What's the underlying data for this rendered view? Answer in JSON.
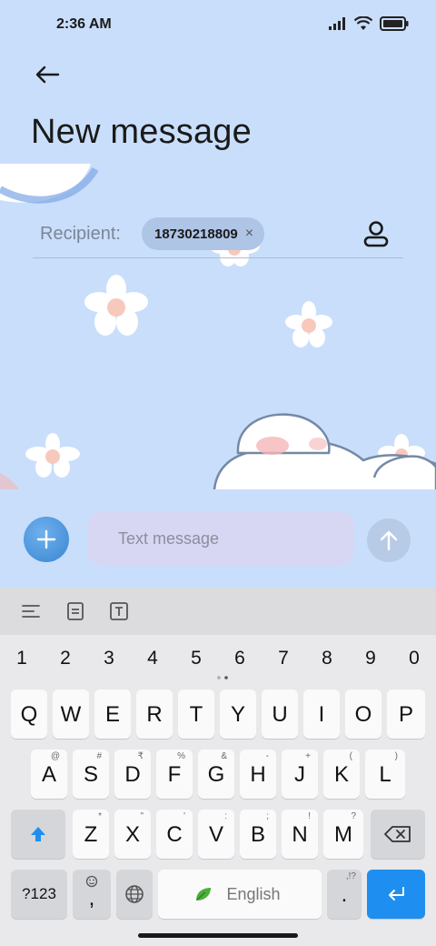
{
  "status_bar": {
    "time": "2:36 AM"
  },
  "header": {
    "title": "New message"
  },
  "recipient": {
    "label": "Recipient:",
    "chip_text": "18730218809",
    "chip_close": "×"
  },
  "compose": {
    "placeholder": "Text message"
  },
  "keyboard": {
    "numbers": [
      "1",
      "2",
      "3",
      "4",
      "5",
      "6",
      "7",
      "8",
      "9",
      "0"
    ],
    "row1": [
      "Q",
      "W",
      "E",
      "R",
      "T",
      "Y",
      "U",
      "I",
      "O",
      "P"
    ],
    "row2": [
      {
        "key": "A",
        "sub": "@"
      },
      {
        "key": "S",
        "sub": "#"
      },
      {
        "key": "D",
        "sub": "₹"
      },
      {
        "key": "F",
        "sub": "%"
      },
      {
        "key": "G",
        "sub": "&"
      },
      {
        "key": "H",
        "sub": "-"
      },
      {
        "key": "J",
        "sub": "+"
      },
      {
        "key": "K",
        "sub": "("
      },
      {
        "key": "L",
        "sub": ")"
      }
    ],
    "row3": [
      {
        "key": "Z",
        "sub": "*"
      },
      {
        "key": "X",
        "sub": "\""
      },
      {
        "key": "C",
        "sub": "'"
      },
      {
        "key": "V",
        "sub": ":"
      },
      {
        "key": "B",
        "sub": ";"
      },
      {
        "key": "N",
        "sub": "!"
      },
      {
        "key": "M",
        "sub": "?"
      }
    ],
    "symbols_label": "?123",
    "comma": ",",
    "space_label": "English",
    "period": ".",
    "period_sub": ",!?"
  },
  "colors": {
    "background": "#c9defb",
    "accent": "#1e8ff0",
    "chip": "#aec5e6"
  }
}
